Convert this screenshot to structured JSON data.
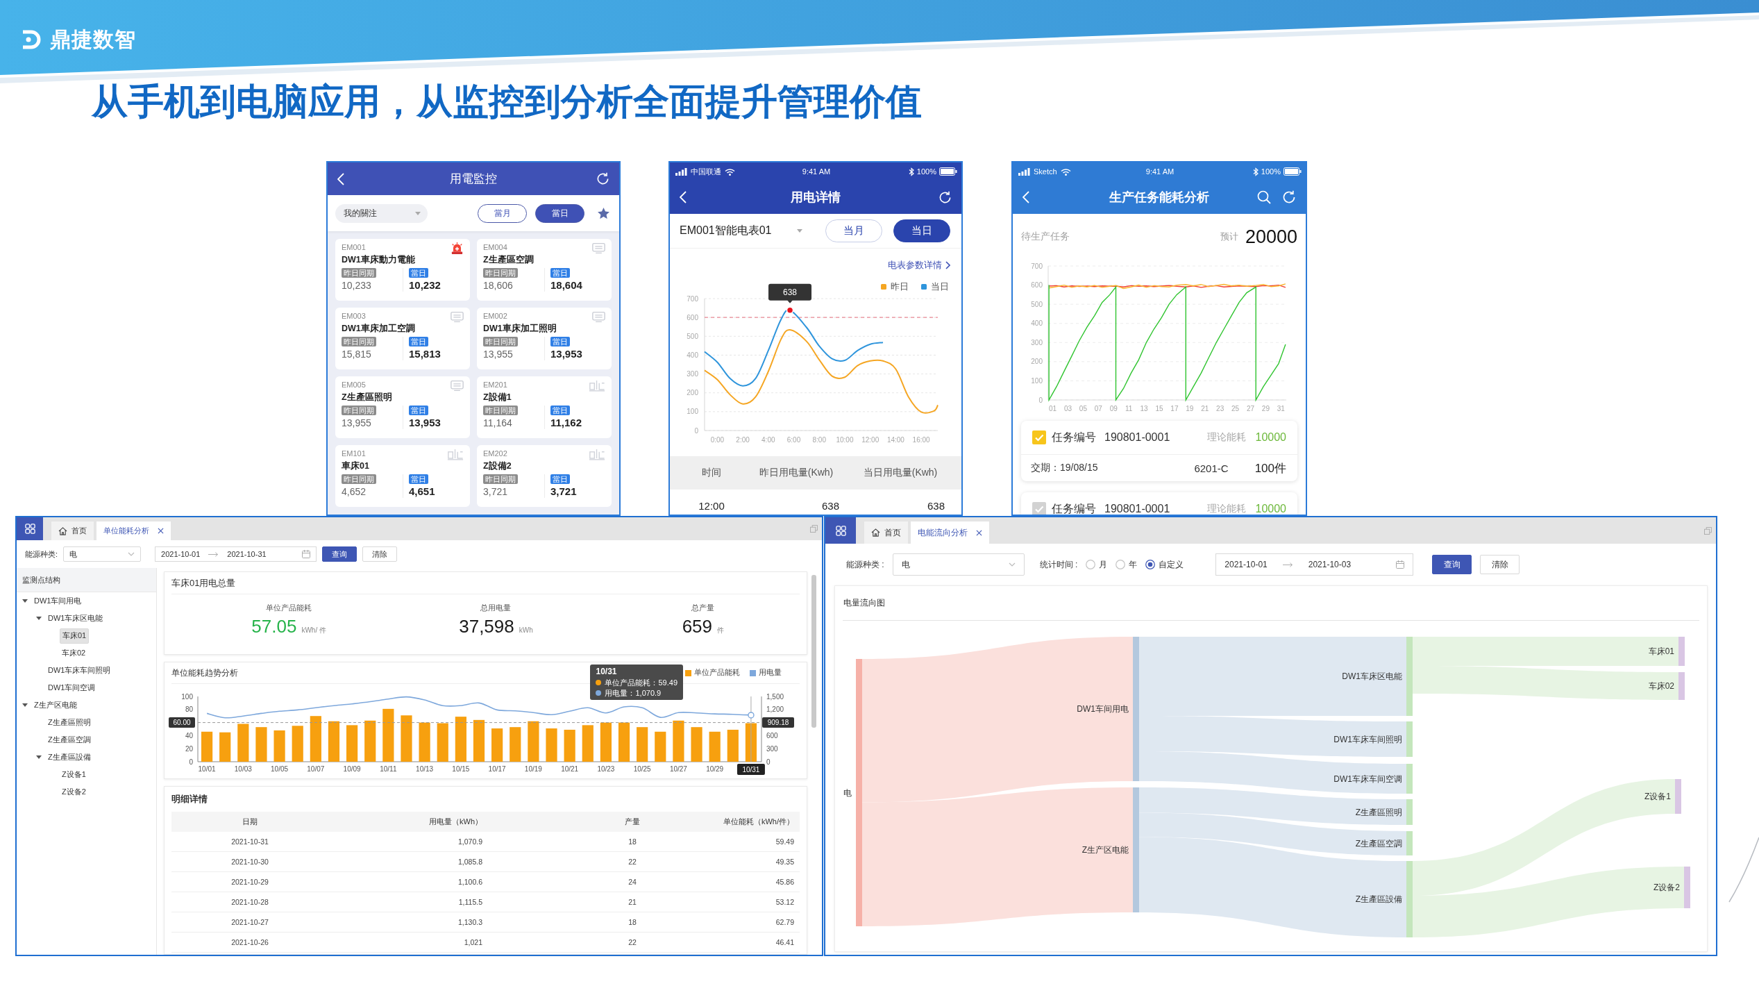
{
  "header": {
    "brand": "鼎捷数智",
    "title": "从手机到电脑应用，从监控到分析全面提升管理价值"
  },
  "monitor_phone": {
    "title": "用電監控",
    "filter": {
      "value": "我的關注"
    },
    "period_tabs": [
      {
        "label": "當月",
        "selected": false
      },
      {
        "label": "當日",
        "selected": true
      }
    ],
    "meters": [
      {
        "code": "EM001",
        "name": "DW1車床動力電能",
        "kind": "alarm",
        "previous_label": "昨日同期",
        "previous": "10,233",
        "current_label": "當日",
        "current": "10,232"
      },
      {
        "code": "EM004",
        "name": "Z生產區空調",
        "kind": "monitor",
        "previous_label": "昨日同期",
        "previous": "18,606",
        "current_label": "當日",
        "current": "18,604"
      },
      {
        "code": "EM003",
        "name": "DW1車床加工空調",
        "kind": "monitor",
        "previous_label": "昨日同期",
        "previous": "15,815",
        "current_label": "當日",
        "current": "15,813"
      },
      {
        "code": "EM002",
        "name": "DW1車床加工照明",
        "kind": "monitor",
        "previous_label": "昨日同期",
        "previous": "13,955",
        "current_label": "當日",
        "current": "13,953"
      },
      {
        "code": "EM005",
        "name": "Z生產區照明",
        "kind": "monitor",
        "previous_label": "昨日同期",
        "previous": "13,955",
        "current_label": "當日",
        "current": "13,953"
      },
      {
        "code": "EM201",
        "name": "Z設備1",
        "kind": "plc",
        "previous_label": "昨日同期",
        "previous": "11,164",
        "current_label": "當日",
        "current": "11,162"
      },
      {
        "code": "EM101",
        "name": "車床01",
        "kind": "plc",
        "previous_label": "昨日同期",
        "previous": "4,652",
        "current_label": "當日",
        "current": "4,651"
      },
      {
        "code": "EM202",
        "name": "Z設備2",
        "kind": "plc",
        "previous_label": "昨日同期",
        "previous": "3,721",
        "current_label": "當日",
        "current": "3,721"
      }
    ]
  },
  "detail_phone": {
    "status_bar": {
      "carrier": "中国联通",
      "time": "9:41 AM",
      "battery": "100%"
    },
    "title": "用电详情",
    "meter": {
      "value": "EM001智能电表01"
    },
    "period_tabs": [
      {
        "label": "当月",
        "selected": false
      },
      {
        "label": "当日",
        "selected": true
      }
    ],
    "detail_link": "电表参数详情",
    "chart_data": {
      "type": "line",
      "x": [
        -1,
        0,
        1,
        2,
        3,
        4,
        5,
        5.7,
        7,
        8,
        9,
        10,
        11,
        12,
        13,
        14,
        15,
        16,
        17,
        17.3
      ],
      "xlim": [
        -1,
        17.3
      ],
      "ylim": [
        0,
        700
      ],
      "xticks": [
        {
          "value": 0,
          "label": "0:00"
        },
        {
          "value": 2,
          "label": "2:00"
        },
        {
          "value": 4,
          "label": "4:00"
        },
        {
          "value": 6,
          "label": "6:00"
        },
        {
          "value": 8,
          "label": "8:00"
        },
        {
          "value": 10,
          "label": "10:00"
        },
        {
          "value": 12,
          "label": "12:00"
        },
        {
          "value": 14,
          "label": "14:00"
        },
        {
          "value": 16,
          "label": "16:00"
        }
      ],
      "yticks": [
        0,
        100,
        200,
        300,
        400,
        500,
        600,
        700
      ],
      "grid": true,
      "series": [
        {
          "name": "昨日",
          "color": "#f5a623",
          "values": [
            319,
            270,
            190,
            141,
            178,
            313,
            485,
            534,
            473,
            375,
            289,
            283,
            344,
            369,
            369,
            326,
            178,
            98,
            104,
            135
          ]
        },
        {
          "name": "当日",
          "color": "#2f95dc",
          "values": [
            418,
            362,
            276,
            237,
            276,
            424,
            590,
            638,
            547,
            448,
            381,
            372,
            424,
            458,
            467,
            null,
            null,
            null,
            null,
            null
          ]
        }
      ],
      "ref_lines": [
        {
          "axis": "y",
          "value": 600
        }
      ],
      "annotations": [
        {
          "text": "638",
          "x": 5.7,
          "y": 638
        }
      ]
    },
    "table": {
      "columns": [
        "时间",
        "昨日用电量(Kwh)",
        "当日用电量(Kwh)"
      ],
      "rows": [
        [
          "12:00",
          "638",
          "638"
        ]
      ]
    }
  },
  "task_phone": {
    "status_bar": {
      "carrier": "Sketch",
      "time": "9:41 AM",
      "battery": "100%"
    },
    "title": "生产任务能耗分析",
    "pending_label": "待生产任务",
    "estimate_label": "预计",
    "estimate": "20000",
    "chart_data": {
      "type": "line",
      "x": [
        0.5,
        0.5,
        1.5,
        2.5,
        3.5,
        4.5,
        5.5,
        6.5,
        7.5,
        8.5,
        9.3,
        9.3,
        10.3,
        11.3,
        12.3,
        13.3,
        14.3,
        15.3,
        16.3,
        17.3,
        18.5,
        18.5,
        19.5,
        20.5,
        21.5,
        22.5,
        23.5,
        24.5,
        25.5,
        26.5,
        27.7,
        27.7,
        28.7,
        29.7,
        30.7,
        31.6
      ],
      "xlim": [
        0.4,
        31.7
      ],
      "ylim": [
        0,
        700
      ],
      "xticks": [
        {
          "value": 1,
          "label": "01"
        },
        {
          "value": 3,
          "label": "03"
        },
        {
          "value": 5,
          "label": "05"
        },
        {
          "value": 7,
          "label": "07"
        },
        {
          "value": 9,
          "label": "09"
        },
        {
          "value": 11,
          "label": "11"
        },
        {
          "value": 13,
          "label": "13"
        },
        {
          "value": 15,
          "label": "15"
        },
        {
          "value": 17,
          "label": "17"
        },
        {
          "value": 19,
          "label": "19"
        },
        {
          "value": 21,
          "label": "21"
        },
        {
          "value": 23,
          "label": "23"
        },
        {
          "value": 25,
          "label": "25"
        },
        {
          "value": 27,
          "label": "27"
        },
        {
          "value": 29,
          "label": "29"
        },
        {
          "value": 31,
          "label": "31"
        }
      ],
      "yticks": [
        0,
        100,
        200,
        300,
        400,
        500,
        600,
        700
      ],
      "grid": true,
      "series": [
        {
          "color": "#f23b2f",
          "values": [
            595,
            595,
            597,
            590,
            596,
            593,
            595,
            592,
            596,
            594,
            595,
            595,
            590,
            597,
            594,
            596,
            592,
            595,
            598,
            594,
            590,
            590,
            596,
            588,
            594,
            597,
            590,
            593,
            596,
            594,
            592,
            592,
            597,
            596,
            600,
            588
          ]
        },
        {
          "color": "#f8b62d",
          "values": [
            585,
            585,
            592,
            600,
            588,
            596,
            590,
            598,
            588,
            594,
            598,
            598,
            582,
            590,
            600,
            588,
            597,
            592,
            590,
            600,
            603,
            603,
            596,
            603,
            592,
            598,
            604,
            596,
            600,
            594,
            598,
            598,
            603,
            592,
            596,
            606
          ]
        },
        {
          "color": "#2fc42f",
          "values": [
            600,
            0,
            70,
            150,
            230,
            310,
            380,
            440,
            510,
            550,
            590,
            0,
            60,
            140,
            210,
            300,
            370,
            430,
            500,
            550,
            590,
            0,
            70,
            140,
            220,
            300,
            370,
            440,
            510,
            560,
            590,
            0,
            70,
            130,
            190,
            290
          ]
        }
      ]
    },
    "tasks": [
      {
        "checked": true,
        "id_label": "任务编号",
        "id": "190801-0001",
        "energy_label": "理论能耗",
        "energy": "10000",
        "due": "交期：19/08/15",
        "model": "6201-C",
        "quantity": "100件"
      },
      {
        "checked": false,
        "id_label": "任务编号",
        "id": "190801-0001",
        "energy_label": "理论能耗",
        "energy": "10000"
      }
    ]
  },
  "unit_window": {
    "tabs": [
      {
        "kind": "home",
        "label": "首页",
        "selected": false,
        "closable": false
      },
      {
        "kind": "page",
        "label": "单位能耗分析",
        "selected": true,
        "closable": true
      }
    ],
    "filters": {
      "energy_label": "能源种类:",
      "energy": "电",
      "date_from": "2021-10-01",
      "date_to": "2021-10-31",
      "query": "查询",
      "clear": "清除"
    },
    "tree": {
      "title": "监测点结构",
      "items": [
        {
          "label": "DW1车间用电",
          "expanded": true,
          "selected": false,
          "children": [
            {
              "label": "DW1车床区电能",
              "expanded": true,
              "selected": false,
              "children": [
                {
                  "label": "车床01",
                  "selected": true
                },
                {
                  "label": "车床02",
                  "selected": false
                }
              ]
            },
            {
              "label": "DW1车床车间照明",
              "selected": false
            },
            {
              "label": "DW1车间空调",
              "selected": false
            }
          ]
        },
        {
          "label": "Z生产区电能",
          "expanded": true,
          "selected": false,
          "children": [
            {
              "label": "Z生產區照明",
              "selected": false
            },
            {
              "label": "Z生產區空調",
              "selected": false
            },
            {
              "label": "Z生產區設備",
              "expanded": true,
              "selected": false,
              "children": [
                {
                  "label": "Z设备1",
                  "selected": false
                },
                {
                  "label": "Z设备2",
                  "selected": false
                }
              ]
            }
          ]
        }
      ]
    },
    "summary": {
      "title": "车床01用电总量",
      "stats": [
        {
          "label": "单位产品能耗",
          "value": "57.05",
          "unit": "kWh/ 件",
          "color": "#26b34a"
        },
        {
          "label": "总用电量",
          "value": "37,598",
          "unit": "kWh",
          "color": "#1a1a1a"
        },
        {
          "label": "总产量",
          "value": "659",
          "unit": "件",
          "color": "#1a1a1a"
        }
      ]
    },
    "trend": {
      "title": "单位能耗趋势分析",
      "chart_data": {
        "type": "bar",
        "categories": [
          "10/01",
          null,
          "10/03",
          null,
          "10/05",
          null,
          "10/07",
          null,
          "10/09",
          null,
          "10/11",
          null,
          "10/13",
          null,
          "10/15",
          null,
          "10/17",
          null,
          "10/19",
          null,
          "10/21",
          null,
          "10/23",
          null,
          "10/25",
          null,
          "10/27",
          null,
          "10/29",
          null,
          "10/31"
        ],
        "ylim": [
          0,
          100
        ],
        "y2lim": [
          0,
          1500
        ],
        "yticks": [
          0,
          20,
          40,
          80,
          100
        ],
        "y2ticks": [
          0,
          300,
          600,
          {
            "value": 1200,
            "label": "1,200"
          },
          {
            "value": 1500,
            "label": "1,500"
          }
        ],
        "series": [
          {
            "name": "单位产品能耗",
            "color": "#f7a00f",
            "values": [
              46,
              45,
              58,
              53,
              48,
              55,
              70,
              62,
              56,
              63,
              81,
              71,
              60,
              59,
              69,
              64,
              51,
              53,
              62,
              51,
              49,
              56,
              60,
              60,
              53,
              46,
              63,
              53,
              46,
              49,
              59
            ]
          },
          {
            "name": "用电量",
            "type": "line",
            "axis": "y2",
            "color": "#7ea8dc",
            "values": [
              1110,
              1010,
              1050,
              1110,
              1160,
              1190,
              1240,
              1290,
              1330,
              1380,
              1440,
              1490,
              1420,
              1290,
              1290,
              1350,
              1190,
              1170,
              1130,
              1080,
              1160,
              1240,
              1120,
              1260,
              1240,
              1020,
              1130,
              1120,
              1100,
              1090,
              1070
            ]
          }
        ],
        "ref_lines": [
          {
            "axis": "y",
            "value": 60,
            "label": "60.00"
          }
        ],
        "annotations": [
          "909.18"
        ]
      },
      "tooltip": {
        "title": "10/31",
        "items": [
          {
            "text": "单位产品能耗：59.49",
            "color": "#f7a00f"
          },
          {
            "text": "用电量：1,070.9",
            "color": "#7ea8dc"
          }
        ]
      }
    },
    "details": {
      "title": "明细详情",
      "columns": [
        "日期",
        "用电量（kWh）",
        "产量",
        "单位能耗（kWh/件）"
      ],
      "rows": [
        [
          "2021-10-31",
          "1,070.9",
          "18",
          "59.49"
        ],
        [
          "2021-10-30",
          "1,085.8",
          "22",
          "49.35"
        ],
        [
          "2021-10-29",
          "1,100.6",
          "24",
          "45.86"
        ],
        [
          "2021-10-28",
          "1,115.5",
          "21",
          "53.12"
        ],
        [
          "2021-10-27",
          "1,130.3",
          "18",
          "62.79"
        ],
        [
          "2021-10-26",
          "1,021",
          "22",
          "46.41"
        ]
      ]
    }
  },
  "flow_window": {
    "tabs": [
      {
        "kind": "home",
        "label": "首页",
        "selected": false,
        "closable": false
      },
      {
        "kind": "page",
        "label": "电能流向分析",
        "selected": true,
        "closable": true
      }
    ],
    "filters": {
      "energy_label": "能源种类 :",
      "energy": "电",
      "period_label": "统计时间 :",
      "periods": [
        {
          "label": "月",
          "selected": false
        },
        {
          "label": "年",
          "selected": false
        },
        {
          "label": "自定义",
          "selected": true
        }
      ],
      "date_from": "2021-10-01",
      "date_to": "2021-10-03",
      "query": "查询",
      "clear": "清除"
    },
    "flow_chart": {
      "title": "电量流向图",
      "root": {
        "label": "电",
        "children": [
          {
            "label": "DW1车间用电",
            "children": [
              {
                "label": "DW1车床区电能",
                "children": [
                  {
                    "label": "车床01"
                  },
                  {
                    "label": "车床02"
                  }
                ]
              },
              {
                "label": "DW1车床车间照明"
              },
              {
                "label": "DW1车床车间空调"
              }
            ]
          },
          {
            "label": "Z生产区电能",
            "children": [
              {
                "label": "Z生產區照明"
              },
              {
                "label": "Z生產區空調"
              },
              {
                "label": "Z生產區設備",
                "children": [
                  {
                    "label": "Z设备1"
                  },
                  {
                    "label": "Z设备2"
                  }
                ]
              }
            ]
          }
        ]
      }
    }
  }
}
